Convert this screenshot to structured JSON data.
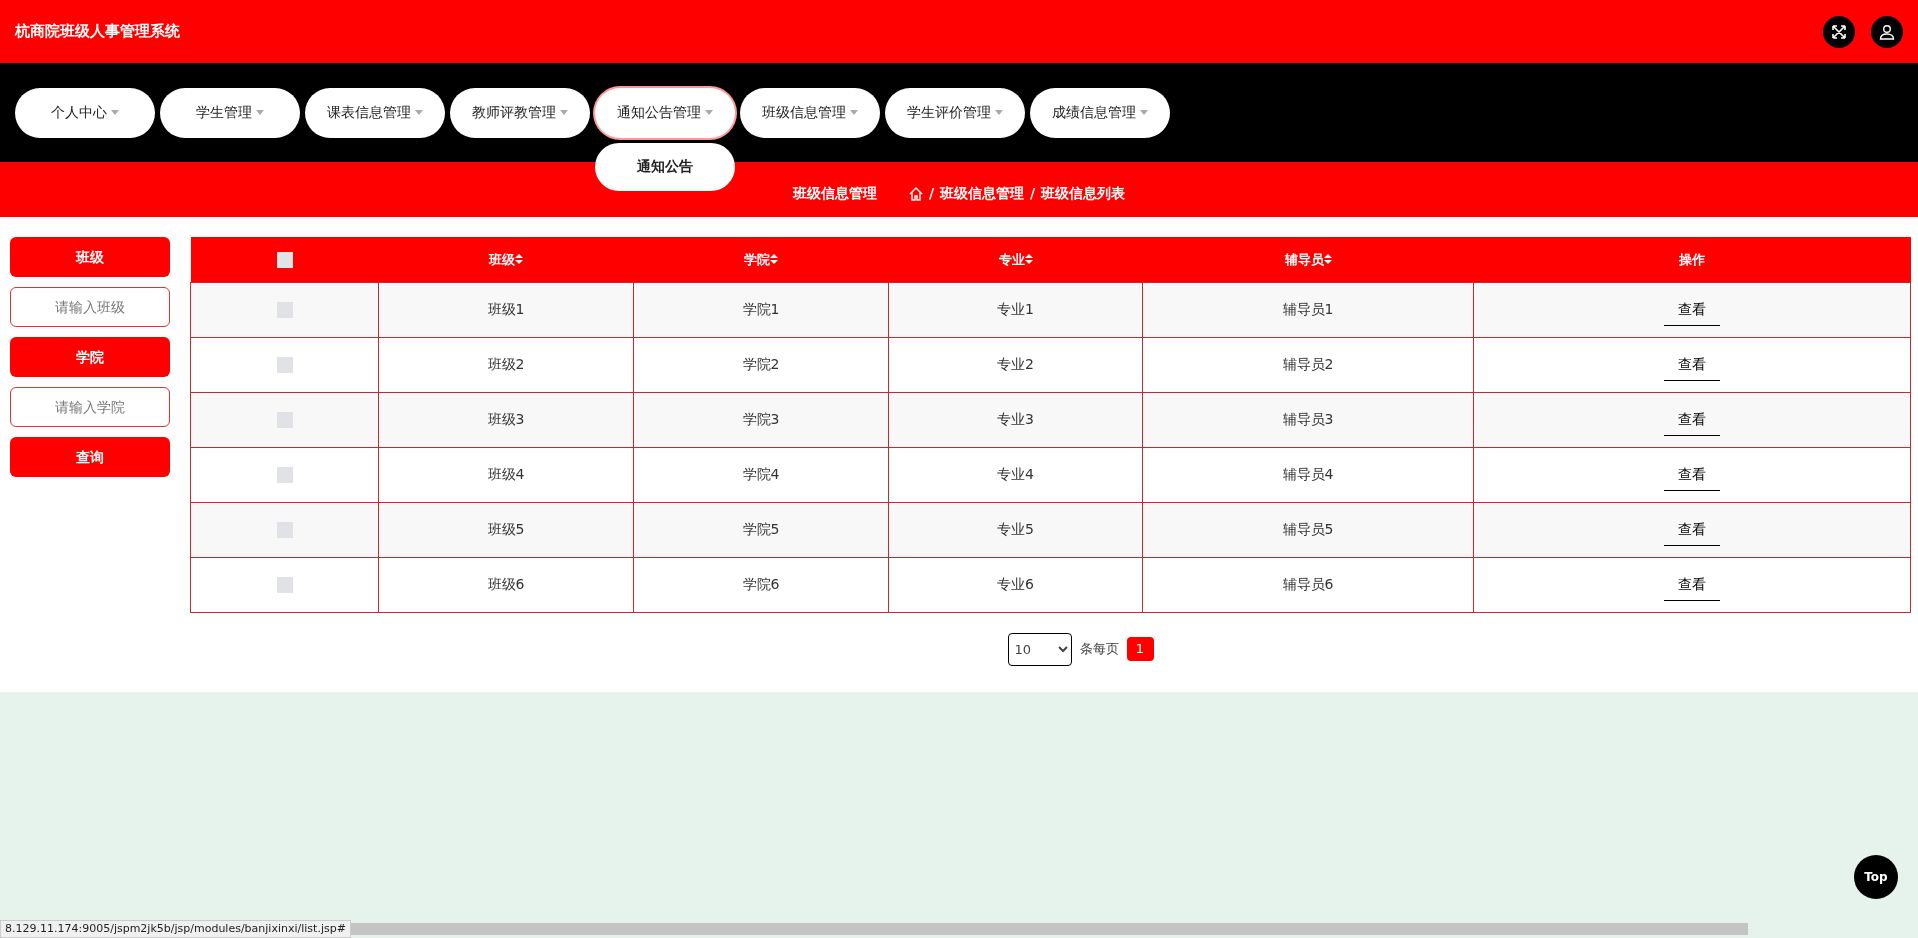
{
  "header": {
    "title": "杭商院班级人事管理系统"
  },
  "nav": [
    {
      "label": "个人中心",
      "expanded": false
    },
    {
      "label": "学生管理",
      "expanded": false
    },
    {
      "label": "课表信息管理",
      "expanded": false
    },
    {
      "label": "教师评教管理",
      "expanded": false
    },
    {
      "label": "通知公告管理",
      "expanded": true,
      "submenu": [
        {
          "label": "通知公告"
        }
      ]
    },
    {
      "label": "班级信息管理",
      "expanded": false
    },
    {
      "label": "学生评价管理",
      "expanded": false
    },
    {
      "label": "成绩信息管理",
      "expanded": false
    }
  ],
  "breadcrumb": {
    "page_title": "班级信息管理",
    "path": [
      {
        "separator": "/",
        "label": "班级信息管理"
      },
      {
        "separator": "/",
        "label": "班级信息列表"
      }
    ]
  },
  "sidebar": {
    "fields": [
      {
        "label": "班级",
        "placeholder": "请输入班级"
      },
      {
        "label": "学院",
        "placeholder": "请输入学院"
      }
    ],
    "button": "查询"
  },
  "table": {
    "columns": [
      {
        "kind": "checkbox",
        "checked": false
      },
      {
        "kind": "sortable",
        "label": "班级"
      },
      {
        "kind": "sortable",
        "label": "学院"
      },
      {
        "kind": "sortable",
        "label": "专业"
      },
      {
        "kind": "sortable",
        "label": "辅导员"
      },
      {
        "kind": "action",
        "label": "操作"
      }
    ],
    "rows": [
      {
        "checked": false,
        "cells": [
          "",
          "班级1",
          "学院1",
          "专业1",
          "辅导员1",
          "查看"
        ]
      },
      {
        "checked": false,
        "cells": [
          "",
          "班级2",
          "学院2",
          "专业2",
          "辅导员2",
          "查看"
        ]
      },
      {
        "checked": false,
        "cells": [
          "",
          "班级3",
          "学院3",
          "专业3",
          "辅导员3",
          "查看"
        ]
      },
      {
        "checked": false,
        "cells": [
          "",
          "班级4",
          "学院4",
          "专业4",
          "辅导员4",
          "查看"
        ]
      },
      {
        "checked": false,
        "cells": [
          "",
          "班级5",
          "学院5",
          "专业5",
          "辅导员5",
          "查看"
        ]
      },
      {
        "checked": false,
        "cells": [
          "",
          "班级6",
          "学院6",
          "专业6",
          "辅导员6",
          "查看"
        ]
      }
    ]
  },
  "pagination": {
    "page_size": "10",
    "per_page_label": "条每页",
    "pages": [
      {
        "label": "1",
        "selected": true
      }
    ]
  },
  "top_button": "Top",
  "status_bar": {
    "url": "8.129.11.174:9005/jspm2jk5b/jsp/modules/banjixinxi/list.jsp#"
  }
}
